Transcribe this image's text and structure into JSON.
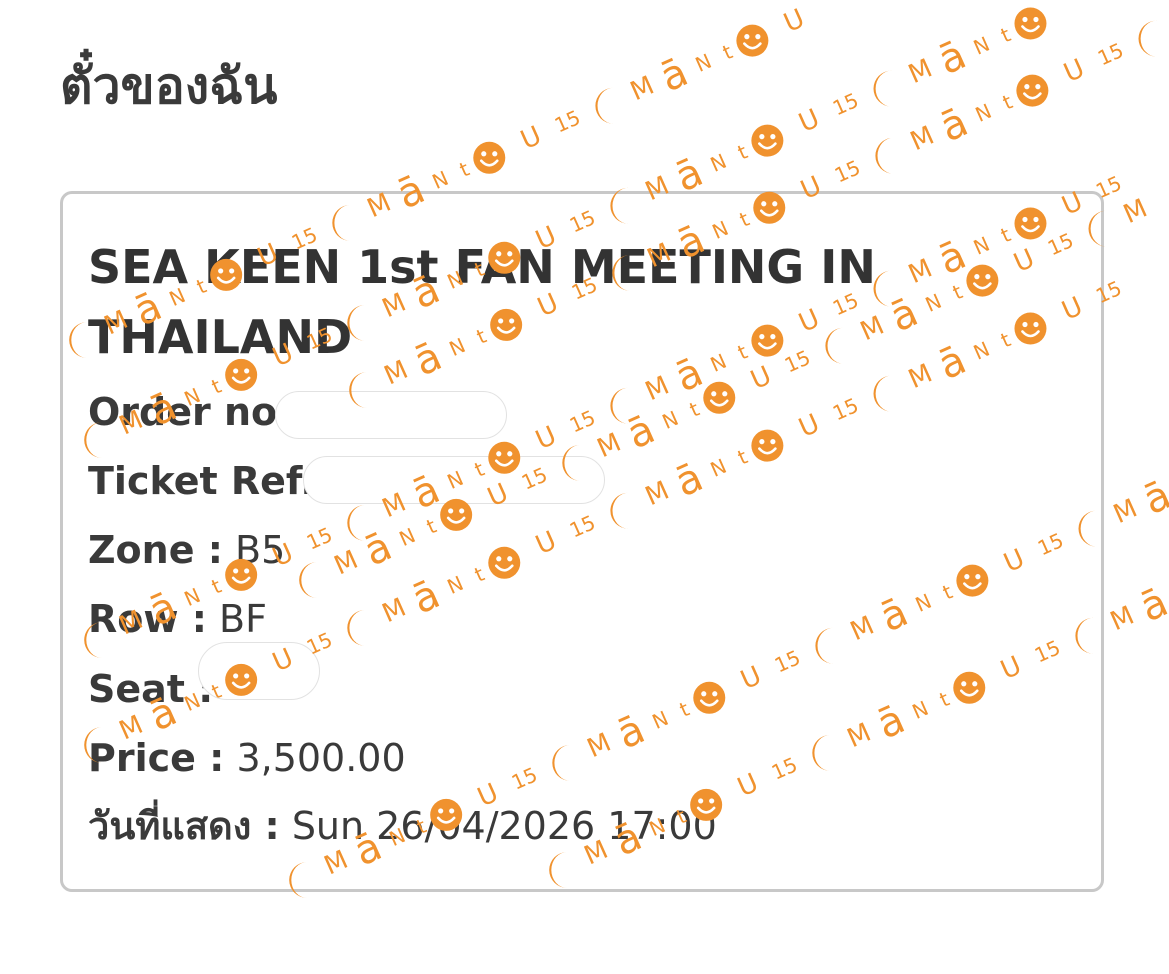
{
  "page": {
    "title": "ตั๋วของฉัน"
  },
  "ticket": {
    "event_title": "SEA KEEN 1st FAN MEETING IN THAILAND",
    "fields": [
      {
        "label": "Order no",
        "value": ""
      },
      {
        "label": "Ticket Ref.",
        "value": ""
      },
      {
        "label": "Zone :",
        "value": "B5"
      },
      {
        "label": "Row :",
        "value": "BF"
      },
      {
        "label": "Seat :",
        "value": ""
      },
      {
        "label": "Price :",
        "value": "3,500.00"
      },
      {
        "label": "วันที่แสดง :",
        "value": "Sun 26/04/2026 17:00"
      }
    ]
  },
  "watermark": {
    "letters": [
      "M",
      "ā",
      "N",
      "t",
      "U"
    ],
    "number": "15",
    "color": "#f0922e",
    "icons": [
      "crescent-moon-icon",
      "smiley-face-icon"
    ]
  }
}
